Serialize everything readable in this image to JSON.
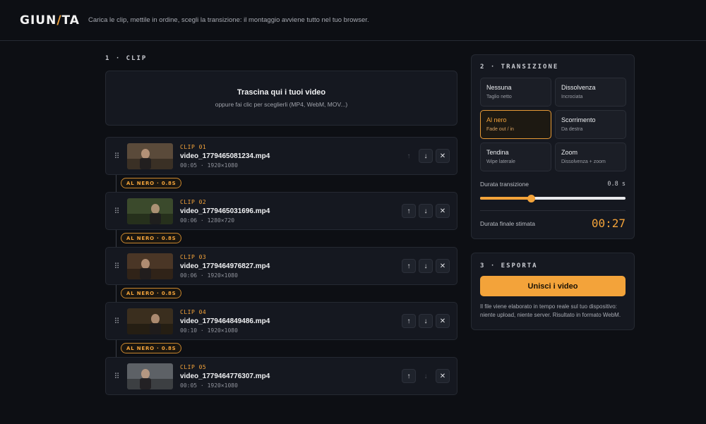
{
  "header": {
    "logo_a": "GIUN",
    "logo_slash": "/",
    "logo_b": "TA",
    "tagline": "Carica le clip, mettile in ordine, scegli la transizione: il montaggio avviene tutto nel tuo browser."
  },
  "clips_section": {
    "label": "1 · CLIP",
    "dropzone": {
      "title": "Trascina qui i tuoi video",
      "subtitle": "oppure fai clic per sceglierli (MP4, WebM, MOV...)"
    },
    "clips": [
      {
        "number": "CLIP 01",
        "filename": "video_1779465081234.mp4",
        "duration": "00:05",
        "resolution": "1920×1080",
        "thumb_color": "#5a4a3a"
      },
      {
        "number": "CLIP 02",
        "filename": "video_1779465031696.mp4",
        "duration": "00:06",
        "resolution": "1280×720",
        "thumb_color": "#3b4a2c"
      },
      {
        "number": "CLIP 03",
        "filename": "video_1779464976827.mp4",
        "duration": "00:06",
        "resolution": "1920×1080",
        "thumb_color": "#4a3626"
      },
      {
        "number": "CLIP 04",
        "filename": "video_1779464849486.mp4",
        "duration": "00:10",
        "resolution": "1920×1080",
        "thumb_color": "#3a2e1e"
      },
      {
        "number": "CLIP 05",
        "filename": "video_1779464776307.mp4",
        "duration": "00:05",
        "resolution": "1920×1080",
        "thumb_color": "#5d6166"
      }
    ],
    "separator": "·",
    "transition_badge": "AL NERO · 0.8S",
    "icons": {
      "handle": "drag-handle-icon",
      "up": "arrow-up-icon",
      "down": "arrow-down-icon",
      "remove": "close-icon"
    }
  },
  "transition_section": {
    "label": "2 · TRANSIZIONE",
    "options": [
      {
        "title": "Nessuna",
        "subtitle": "Taglio netto",
        "active": false
      },
      {
        "title": "Dissolvenza",
        "subtitle": "Incrociata",
        "active": false
      },
      {
        "title": "Al nero",
        "subtitle": "Fade out / in",
        "active": true
      },
      {
        "title": "Scorrimento",
        "subtitle": "Da destra",
        "active": false
      },
      {
        "title": "Tendina",
        "subtitle": "Wipe laterale",
        "active": false
      },
      {
        "title": "Zoom",
        "subtitle": "Dissolvenza + zoom",
        "active": false
      }
    ],
    "duration_label": "Durata transizione",
    "duration_value": "0.8 s",
    "duration_fraction": 0.35,
    "final_label": "Durata finale stimata",
    "final_value": "00:27"
  },
  "export_section": {
    "label": "3 · ESPORTA",
    "button": "Unisci i video",
    "note": "Il file viene elaborato in tempo reale sul tuo dispositivo: niente upload, niente server. Risultato in formato WebM."
  },
  "colors": {
    "accent": "#f3a33a",
    "background": "#0d0f14",
    "card": "#151820"
  }
}
